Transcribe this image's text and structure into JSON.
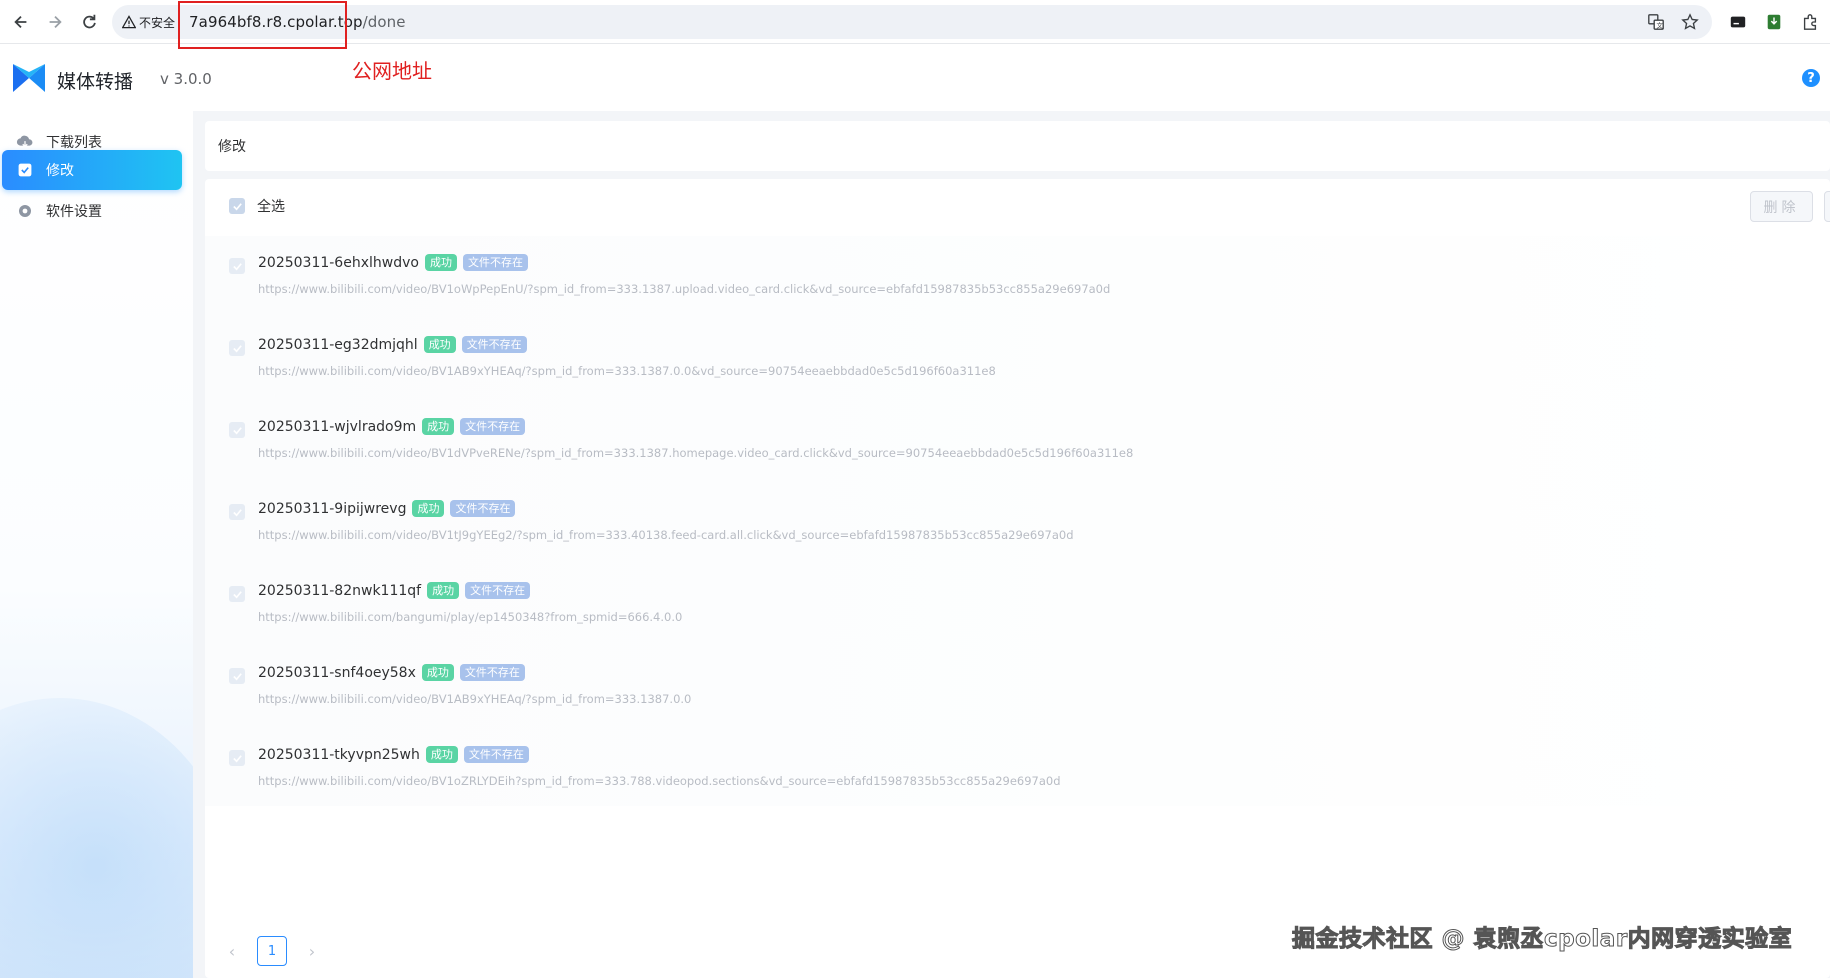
{
  "browser": {
    "security_label": "不安全",
    "url_host": "7a964bf8.r8.cpolar.top",
    "url_path": "/done",
    "annotation": "公网地址"
  },
  "app": {
    "name": "媒体转播",
    "version": "v 3.0.0",
    "help_symbol": "?"
  },
  "sidebar": {
    "items": [
      {
        "label": "下载列表",
        "icon": "cloud-download-icon",
        "active": false
      },
      {
        "label": "修改",
        "icon": "checkbox-icon",
        "active": true
      },
      {
        "label": "软件设置",
        "icon": "gear-icon",
        "active": false
      }
    ]
  },
  "main": {
    "page_title": "修改",
    "select_all_label": "全选",
    "delete_label": "删除",
    "items": [
      {
        "title": "20250311-6ehxlhwdvo",
        "status": "成功",
        "file_status": "文件不存在",
        "url": "https://www.bilibili.com/video/BV1oWpPepEnU/?spm_id_from=333.1387.upload.video_card.click&vd_source=ebfafd15987835b53cc855a29e697a0d"
      },
      {
        "title": "20250311-eg32dmjqhl",
        "status": "成功",
        "file_status": "文件不存在",
        "url": "https://www.bilibili.com/video/BV1AB9xYHEAq/?spm_id_from=333.1387.0.0&vd_source=90754eeaebbdad0e5c5d196f60a311e8"
      },
      {
        "title": "20250311-wjvlrado9m",
        "status": "成功",
        "file_status": "文件不存在",
        "url": "https://www.bilibili.com/video/BV1dVPveRENe/?spm_id_from=333.1387.homepage.video_card.click&vd_source=90754eeaebbdad0e5c5d196f60a311e8"
      },
      {
        "title": "20250311-9ipijwrevg",
        "status": "成功",
        "file_status": "文件不存在",
        "url": "https://www.bilibili.com/video/BV1tJ9gYEEg2/?spm_id_from=333.40138.feed-card.all.click&vd_source=ebfafd15987835b53cc855a29e697a0d"
      },
      {
        "title": "20250311-82nwk111qf",
        "status": "成功",
        "file_status": "文件不存在",
        "url": "https://www.bilibili.com/bangumi/play/ep1450348?from_spmid=666.4.0.0"
      },
      {
        "title": "20250311-snf4oey58x",
        "status": "成功",
        "file_status": "文件不存在",
        "url": "https://www.bilibili.com/video/BV1AB9xYHEAq/?spm_id_from=333.1387.0.0"
      },
      {
        "title": "20250311-tkyvpn25wh",
        "status": "成功",
        "file_status": "文件不存在",
        "url": "https://www.bilibili.com/video/BV1oZRLYDEih?spm_id_from=333.788.videopod.sections&vd_source=ebfafd15987835b53cc855a29e697a0d"
      }
    ]
  },
  "pagination": {
    "prev": "‹",
    "current": "1",
    "next": "›"
  },
  "watermark": "掘金技术社区 @ 袁煦丞cpolar内网穿透实验室",
  "colors": {
    "accent": "#2a8cff",
    "success_tag": "#5ad4a4",
    "missing_tag": "#a8c2ec",
    "annotation_red": "#e02020"
  }
}
